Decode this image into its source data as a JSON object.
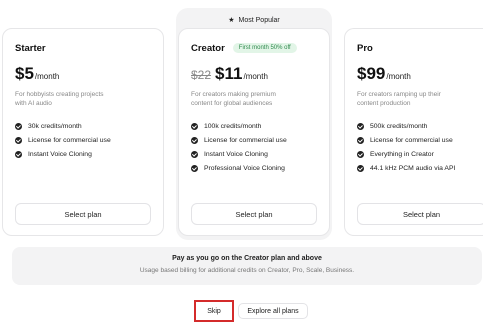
{
  "popular": {
    "label": "Most Popular",
    "icon": "star-icon"
  },
  "plans": [
    {
      "name": "Starter",
      "badge": "",
      "old_price": "",
      "price": "$5",
      "per": "/month",
      "desc": [
        "For hobbyists creating projects",
        "with AI audio"
      ],
      "features": [
        "30k credits/month",
        "License for commercial use",
        "Instant Voice Cloning"
      ],
      "button": "Select plan"
    },
    {
      "name": "Creator",
      "badge": "First month 50% off",
      "old_price": "$22",
      "price": "$11",
      "per": "/month",
      "desc": [
        "For creators making premium",
        "content for global audiences"
      ],
      "features": [
        "100k credits/month",
        "License for commercial use",
        "Instant Voice Cloning",
        "Professional Voice Cloning"
      ],
      "button": "Select plan"
    },
    {
      "name": "Pro",
      "badge": "",
      "old_price": "",
      "price": "$99",
      "per": "/month",
      "desc": [
        "For creators ramping up their",
        "content production"
      ],
      "features": [
        "500k credits/month",
        "License for commercial use",
        "Everything in Creator",
        "44.1 kHz PCM audio via API"
      ],
      "button": "Select plan"
    }
  ],
  "payg": {
    "title": "Pay as you go on the Creator plan and above",
    "subtitle": "Usage based billing for additional credits on Creator, Pro, Scale, Business."
  },
  "actions": {
    "skip": "Skip",
    "explore": "Explore all plans"
  },
  "colors": {
    "badge_green": "#2f8a4d",
    "highlight_red": "#d42b2b"
  }
}
